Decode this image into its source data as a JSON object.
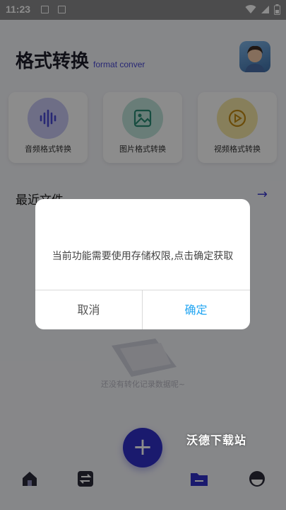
{
  "status_bar": {
    "time": "11:23",
    "icons": [
      "image-icon",
      "a-icon",
      "wifi-icon",
      "signal-icon",
      "battery-icon"
    ]
  },
  "header": {
    "title": "格式转换",
    "subtitle": "format conver"
  },
  "tools": [
    {
      "label": "音频格式转换",
      "icon": "audio-wave-icon",
      "color": "#c8c8f5"
    },
    {
      "label": "图片格式转换",
      "icon": "image-icon",
      "color": "#bfe3da"
    },
    {
      "label": "视频格式转换",
      "icon": "play-icon",
      "color": "#f6e7a6"
    }
  ],
  "recent": {
    "title": "最近文件",
    "arrow": "→",
    "empty_text": "还没有转化记录数据呢~"
  },
  "fab": {
    "label": "+"
  },
  "tabbar": {
    "items": [
      "home-icon",
      "swap-icon",
      "folder-icon",
      "profile-icon"
    ],
    "active": "folder-icon"
  },
  "watermark": "沃德下载站",
  "dialog": {
    "message": "当前功能需要使用存储权限,点击确定获取",
    "cancel_label": "取消",
    "confirm_label": "确定"
  },
  "colors": {
    "accent": "#3030c8",
    "confirm": "#21a5f2",
    "overlay": "rgba(0,0,0,0.45)"
  }
}
